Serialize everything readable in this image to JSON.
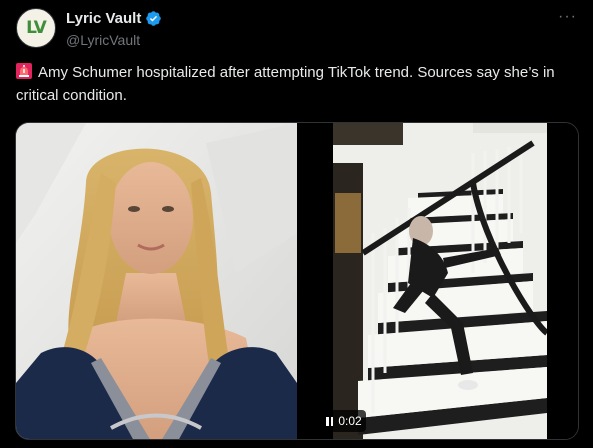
{
  "account": {
    "avatar_text": "LV",
    "display_name": "Lyric Vault",
    "handle": "@LyricVault",
    "verified": true
  },
  "more_icon": "···",
  "tweet": {
    "emoji": "siren-icon",
    "text": "Amy Schumer hospitalized after attempting TikTok trend. Sources say she’s in critical condition."
  },
  "media": {
    "left_image": "photo-red-carpet-portrait",
    "right_image": "video-woman-falling-on-stairs",
    "video_time": "0:02",
    "video_state": "playing"
  },
  "colors": {
    "background": "#000000",
    "text": "#e7e9ea",
    "secondary": "#71767b",
    "verified": "#1d9bf0",
    "avatar_green": "#3f8f3a"
  }
}
